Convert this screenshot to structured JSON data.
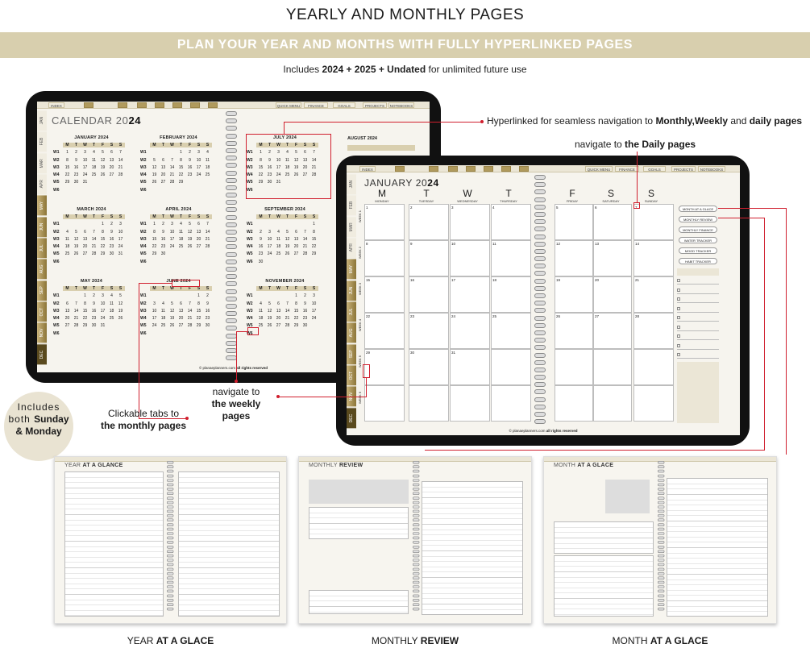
{
  "header": {
    "title": "YEARLY AND MONTHLY PAGES",
    "banner": "PLAN YOUR YEAR AND MONTHS WITH FULLY HYPERLINKED PAGES",
    "includes_pre": "Includes ",
    "includes_bold": "2024 + 2025 + Undated",
    "includes_post": " for unlimited future use"
  },
  "nav": {
    "index": "INDEX",
    "tabs": [
      "QUICK MENU",
      "FINANCE",
      "GOALS",
      "PROJECTS",
      "NOTEBOOKS"
    ]
  },
  "sidebar_months": [
    "JAN",
    "FEB",
    "MAR",
    "APR",
    "MAY",
    "JUN",
    "JUL",
    "AUG",
    "SEP",
    "OCT",
    "NOV",
    "DEC"
  ],
  "calendar": {
    "title_light": "CALENDAR 20",
    "title_bold": "24",
    "day_heads": [
      "M",
      "T",
      "W",
      "T",
      "F",
      "S",
      "S"
    ],
    "months": [
      {
        "name": "JANUARY 20",
        "yr": "24",
        "rows": [
          [
            "W1",
            "1",
            "2",
            "3",
            "4",
            "5",
            "6",
            "7"
          ],
          [
            "W2",
            "8",
            "9",
            "10",
            "11",
            "12",
            "13",
            "14"
          ],
          [
            "W3",
            "15",
            "16",
            "17",
            "18",
            "19",
            "20",
            "21"
          ],
          [
            "W4",
            "22",
            "23",
            "24",
            "25",
            "26",
            "27",
            "28"
          ],
          [
            "W5",
            "29",
            "30",
            "31",
            "",
            "",
            "",
            ""
          ],
          [
            "W6",
            "",
            "",
            "",
            "",
            "",
            "",
            ""
          ]
        ]
      },
      {
        "name": "FEBRUARY 20",
        "yr": "24",
        "rows": [
          [
            "W1",
            "",
            "",
            "",
            "1",
            "2",
            "3",
            "4"
          ],
          [
            "W2",
            "5",
            "6",
            "7",
            "8",
            "9",
            "10",
            "11"
          ],
          [
            "W3",
            "12",
            "13",
            "14",
            "15",
            "16",
            "17",
            "18"
          ],
          [
            "W4",
            "19",
            "20",
            "21",
            "22",
            "23",
            "24",
            "25"
          ],
          [
            "W5",
            "26",
            "27",
            "28",
            "29",
            "",
            "",
            ""
          ],
          [
            "W6",
            "",
            "",
            "",
            "",
            "",
            "",
            ""
          ]
        ]
      },
      {
        "name": "JULY 20",
        "yr": "24",
        "rows": [
          [
            "W1",
            "1",
            "2",
            "3",
            "4",
            "5",
            "6",
            "7"
          ],
          [
            "W2",
            "8",
            "9",
            "10",
            "11",
            "12",
            "13",
            "14"
          ],
          [
            "W3",
            "15",
            "16",
            "17",
            "18",
            "19",
            "20",
            "21"
          ],
          [
            "W4",
            "22",
            "23",
            "24",
            "25",
            "26",
            "27",
            "28"
          ],
          [
            "W5",
            "29",
            "30",
            "31",
            "",
            "",
            "",
            ""
          ],
          [
            "W6",
            "",
            "",
            "",
            "",
            "",
            "",
            ""
          ]
        ]
      },
      {
        "name": "MARCH 20",
        "yr": "24",
        "rows": [
          [
            "W1",
            "",
            "",
            "",
            "",
            "1",
            "2",
            "3"
          ],
          [
            "W2",
            "4",
            "5",
            "6",
            "7",
            "8",
            "9",
            "10"
          ],
          [
            "W3",
            "11",
            "12",
            "13",
            "14",
            "15",
            "16",
            "17"
          ],
          [
            "W4",
            "18",
            "19",
            "20",
            "21",
            "22",
            "23",
            "24"
          ],
          [
            "W5",
            "25",
            "26",
            "27",
            "28",
            "29",
            "30",
            "31"
          ],
          [
            "W6",
            "",
            "",
            "",
            "",
            "",
            "",
            ""
          ]
        ]
      },
      {
        "name": "APRIL 20",
        "yr": "24",
        "rows": [
          [
            "W1",
            "1",
            "2",
            "3",
            "4",
            "5",
            "6",
            "7"
          ],
          [
            "W2",
            "8",
            "9",
            "10",
            "11",
            "12",
            "13",
            "14"
          ],
          [
            "W3",
            "15",
            "16",
            "17",
            "18",
            "19",
            "20",
            "21"
          ],
          [
            "W4",
            "22",
            "23",
            "24",
            "25",
            "26",
            "27",
            "28"
          ],
          [
            "W5",
            "29",
            "30",
            "",
            "",
            "",
            "",
            ""
          ],
          [
            "W6",
            "",
            "",
            "",
            "",
            "",
            "",
            ""
          ]
        ]
      },
      {
        "name": "SEPTEMBER 20",
        "yr": "24",
        "rows": [
          [
            "W1",
            "",
            "",
            "",
            "",
            "",
            "",
            "1"
          ],
          [
            "W2",
            "2",
            "3",
            "4",
            "5",
            "6",
            "7",
            "8"
          ],
          [
            "W3",
            "9",
            "10",
            "11",
            "12",
            "13",
            "14",
            "15"
          ],
          [
            "W4",
            "16",
            "17",
            "18",
            "19",
            "20",
            "21",
            "22"
          ],
          [
            "W5",
            "23",
            "24",
            "25",
            "26",
            "27",
            "28",
            "29"
          ],
          [
            "W6",
            "30",
            "",
            "",
            "",
            "",
            "",
            ""
          ]
        ]
      },
      {
        "name": "MAY 20",
        "yr": "24",
        "rows": [
          [
            "W1",
            "",
            "",
            "1",
            "2",
            "3",
            "4",
            "5"
          ],
          [
            "W2",
            "6",
            "7",
            "8",
            "9",
            "10",
            "11",
            "12"
          ],
          [
            "W3",
            "13",
            "14",
            "15",
            "16",
            "17",
            "18",
            "19"
          ],
          [
            "W4",
            "20",
            "21",
            "22",
            "23",
            "24",
            "25",
            "26"
          ],
          [
            "W5",
            "27",
            "28",
            "29",
            "30",
            "31",
            "",
            ""
          ],
          [
            "W6",
            "",
            "",
            "",
            "",
            "",
            "",
            ""
          ]
        ]
      },
      {
        "name": "JUNE 20",
        "yr": "24",
        "rows": [
          [
            "W1",
            "",
            "",
            "",
            "",
            "",
            "1",
            "2"
          ],
          [
            "W2",
            "3",
            "4",
            "5",
            "6",
            "7",
            "8",
            "9"
          ],
          [
            "W3",
            "10",
            "11",
            "12",
            "13",
            "14",
            "15",
            "16"
          ],
          [
            "W4",
            "17",
            "18",
            "19",
            "20",
            "21",
            "22",
            "23"
          ],
          [
            "W5",
            "24",
            "25",
            "26",
            "27",
            "28",
            "29",
            "30"
          ],
          [
            "W6",
            "",
            "",
            "",
            "",
            "",
            "",
            ""
          ]
        ]
      },
      {
        "name": "NOVEMBER 20",
        "yr": "24",
        "rows": [
          [
            "W1",
            "",
            "",
            "",
            "",
            "1",
            "2",
            "3"
          ],
          [
            "W2",
            "4",
            "5",
            "6",
            "7",
            "8",
            "9",
            "10"
          ],
          [
            "W3",
            "11",
            "12",
            "13",
            "14",
            "15",
            "16",
            "17"
          ],
          [
            "W4",
            "18",
            "19",
            "20",
            "21",
            "22",
            "23",
            "24"
          ],
          [
            "W5",
            "25",
            "26",
            "27",
            "28",
            "29",
            "30",
            ""
          ],
          [
            "W6",
            "",
            "",
            "",
            "",
            "",
            "",
            ""
          ]
        ]
      }
    ],
    "august": "AUGUST 2024",
    "footer_pre": "© planaeplanners.com",
    "footer_post": " all rights reserved"
  },
  "monthly": {
    "title_light": "JANUARY 20",
    "title_bold": "24",
    "days": [
      {
        "l": "M",
        "n": "MONDAY"
      },
      {
        "l": "T",
        "n": "TUESDAY"
      },
      {
        "l": "W",
        "n": "WEDNESDAY"
      },
      {
        "l": "T",
        "n": "THURSDAY"
      },
      {
        "l": "F",
        "n": "FRIDAY"
      },
      {
        "l": "S",
        "n": "SATURDAY"
      },
      {
        "l": "S",
        "n": "SUNDAY"
      }
    ],
    "weeks": [
      "WEEK 1",
      "WEEK 2",
      "WEEK 3",
      "WEEK 4",
      "WEEK 5",
      "WEEK 6"
    ],
    "cells": [
      [
        "1",
        "2",
        "3",
        "4",
        "5",
        "6",
        "7"
      ],
      [
        "8",
        "9",
        "10",
        "11",
        "12",
        "13",
        "14"
      ],
      [
        "15",
        "16",
        "17",
        "18",
        "19",
        "20",
        "21"
      ],
      [
        "22",
        "23",
        "24",
        "25",
        "26",
        "27",
        "28"
      ],
      [
        "29",
        "30",
        "31",
        "",
        "",
        "",
        ""
      ],
      [
        "",
        "",
        "",
        "",
        "",
        "",
        ""
      ]
    ],
    "quick_buttons": [
      "MONTH AT A GLACE",
      "MONTHLY REVIEW",
      "MONTHLY FINANCE",
      "WATER TRACKER",
      "MOOD TRACKER",
      "HABIT TRACKER"
    ],
    "footer_pre": "© planaeplanners.com",
    "footer_post": " all rights reserved"
  },
  "annotations": {
    "hyper_pre": "Hyperlinked for seamless navigation to ",
    "hyper_b1": "Monthly,Weekly",
    "hyper_mid": " and ",
    "hyper_b2": "daily pages",
    "daily_pre": "navigate to ",
    "daily_b": "the Daily pages",
    "weekly_line1": "navigate to",
    "weekly_b": "the weekly pages",
    "tabs_line1": "Clickable tabs to",
    "tabs_b": "the monthly pages"
  },
  "badge": {
    "line1": "Includes",
    "line2_pre": "both ",
    "line2_b": "Sunday",
    "line3_b": "& Monday"
  },
  "thumbs": [
    {
      "title_light": "YEAR ",
      "title_bold": "AT A GLANCE",
      "cap_light": "YEAR ",
      "cap_bold": "AT A GLACE"
    },
    {
      "title_light": "MONTHLY ",
      "title_bold": "REVIEW",
      "cap_light": "MONTHLY ",
      "cap_bold": "REVIEW"
    },
    {
      "title_light": "MONTH ",
      "title_bold": "AT A GLACE",
      "cap_light": "MONTH ",
      "cap_bold": "AT A GLACE"
    }
  ],
  "colors": {
    "gold": "#b09a5d",
    "band": "#d8cfae",
    "accent_red": "#d01f2e"
  }
}
